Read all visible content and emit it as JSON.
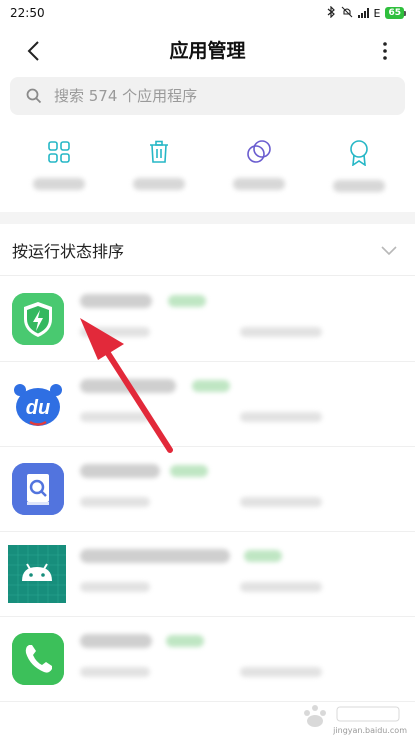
{
  "status_bar": {
    "time": "22:50",
    "network": "E",
    "battery": "65"
  },
  "header": {
    "title": "应用管理"
  },
  "search": {
    "placeholder": "搜索 574 个应用程序"
  },
  "quick_actions": [
    {
      "icon": "grid-icon",
      "label": ""
    },
    {
      "icon": "trash-icon",
      "label": ""
    },
    {
      "icon": "dual-circle-icon",
      "label": ""
    },
    {
      "icon": "award-icon",
      "label": ""
    }
  ],
  "sort": {
    "label": "按运行状态排序"
  },
  "apps": [
    {
      "icon": "security-shield-icon",
      "icon_bg": "#3ec46d",
      "name": "",
      "badge": "",
      "meta1": "",
      "meta2": ""
    },
    {
      "icon": "baidu-du-icon",
      "icon_bg": "#ffffff",
      "name": "",
      "badge": "",
      "meta1": "",
      "meta2": ""
    },
    {
      "icon": "doc-search-icon",
      "icon_bg": "#4f6fdc",
      "name": "",
      "badge": "",
      "meta1": "",
      "meta2": ""
    },
    {
      "icon": "android-icon",
      "icon_bg": "#168f7d",
      "name": "",
      "badge": "",
      "meta1": "",
      "meta2": ""
    },
    {
      "icon": "phone-icon",
      "icon_bg": "#3cc05a",
      "name": "",
      "badge": "",
      "meta1": "",
      "meta2": ""
    }
  ],
  "colors": {
    "accent": "#26b7c6",
    "running_badge": "#bfe6c3",
    "arrow": "#e2293a"
  },
  "watermark": {
    "text": "jingyan.baidu.com"
  }
}
